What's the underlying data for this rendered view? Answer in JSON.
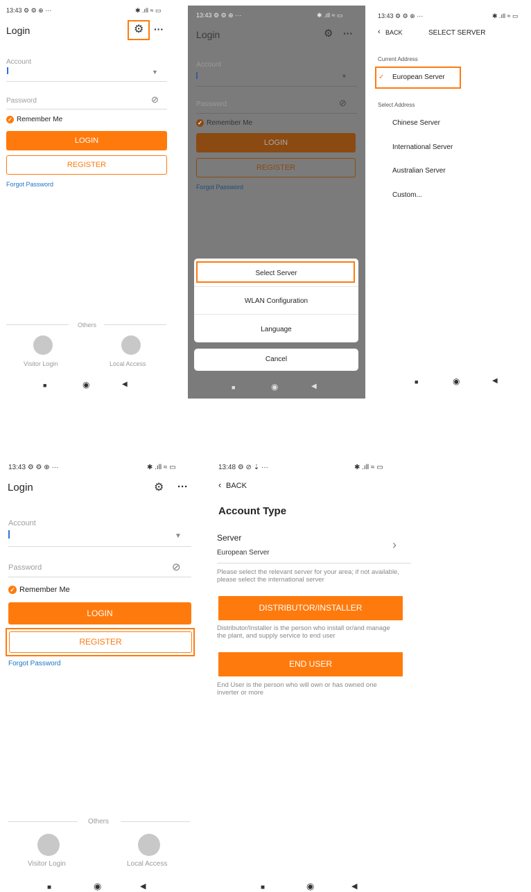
{
  "status": {
    "s1": "13:43 ⚙ ⚙ ⊕  ···",
    "s2": "13:43 ⚙ ⚙ ⊕  ···",
    "s3": "13:43 ⚙ ⚙ ⊕  ···",
    "s4": "13:43 ⚙ ⚙ ⊕  ···",
    "s5": "13:48 ⚙ ⊘ ⇣  ···",
    "right": "✱ .ıll ≈ ▭"
  },
  "login": {
    "title": "Login",
    "account": "Account",
    "password": "Password",
    "remember": "Remember Me",
    "login_btn": "LOGIN",
    "register_btn": "REGISTER",
    "forgot": "Forgot Password",
    "others": "Others",
    "visitor": "Visitor Login",
    "local": "Local Access",
    "more": "···"
  },
  "sheet": {
    "select_server": "Select Server",
    "wlan": "WLAN Configuration",
    "language": "Language",
    "cancel": "Cancel"
  },
  "server": {
    "back": "BACK",
    "title": "SELECT SERVER",
    "current_label": "Current Address",
    "current": "European Server",
    "select_label": "Select Address",
    "options": [
      "Chinese Server",
      "International Server",
      "Australian Server",
      "Custom..."
    ]
  },
  "account_type": {
    "back": "BACK",
    "title": "Account Type",
    "server_label": "Server",
    "server_value": "European Server",
    "server_hint": "Please select the relevant server for your area; if not available, please select the international server",
    "distributor_btn": "DISTRIBUTOR/INSTALLER",
    "distributor_desc": "Distributor/Installer is the person who install or/and manage the plant, and supply service to end user",
    "enduser_btn": "END USER",
    "enduser_desc": "End User is the person who will own or has owned one inverter or more"
  },
  "colors": {
    "accent": "#ff7a0d",
    "link": "#1e73c8",
    "overlay": "#7b7b7b"
  }
}
